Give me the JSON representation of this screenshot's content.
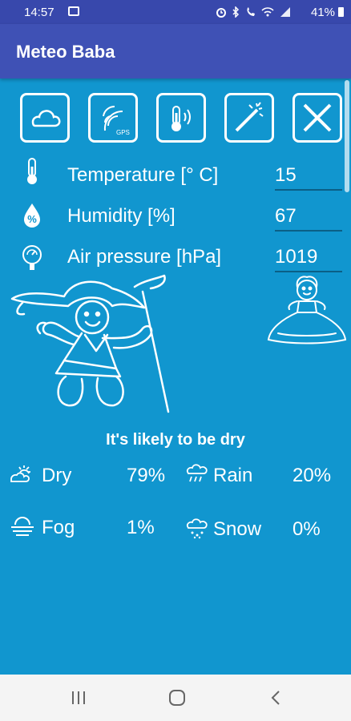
{
  "status_bar": {
    "time": "14:57",
    "battery": "41%",
    "icons": [
      "image-icon",
      "alarm-icon",
      "bluetooth-icon",
      "wifi-calling-icon",
      "wifi-icon",
      "signal-icon",
      "battery-icon"
    ]
  },
  "app_bar": {
    "title": "Meteo Baba"
  },
  "toolbar": {
    "buttons": [
      "cloud-icon",
      "gps-icon",
      "thermometer-sound-icon",
      "magic-wand-icon",
      "close-icon"
    ],
    "gps_caption": "GPS"
  },
  "readings": [
    {
      "icon": "thermometer-icon",
      "label": "Temperature [° C]",
      "value": "15"
    },
    {
      "icon": "humidity-icon",
      "label": "Humidity [%]",
      "value": "67"
    },
    {
      "icon": "barometer-icon",
      "label": "Air pressure [hPa]",
      "value": "1019"
    }
  ],
  "forecast": {
    "headline": "It's likely to be dry",
    "items": [
      {
        "icon": "sun-cloud-icon",
        "label": "Dry",
        "value": "79%"
      },
      {
        "icon": "rain-icon",
        "label": "Rain",
        "value": "20%"
      },
      {
        "icon": "fog-icon",
        "label": "Fog",
        "value": "1%"
      },
      {
        "icon": "snow-icon",
        "label": "Snow",
        "value": "0%"
      }
    ]
  },
  "colors": {
    "background": "#1196cf",
    "app_bar": "#3f51b5",
    "status_bar": "#3848ac",
    "nav_bar": "#f4f4f4"
  },
  "nav_bar": {
    "buttons": [
      "recents-icon",
      "home-icon",
      "back-icon"
    ]
  }
}
